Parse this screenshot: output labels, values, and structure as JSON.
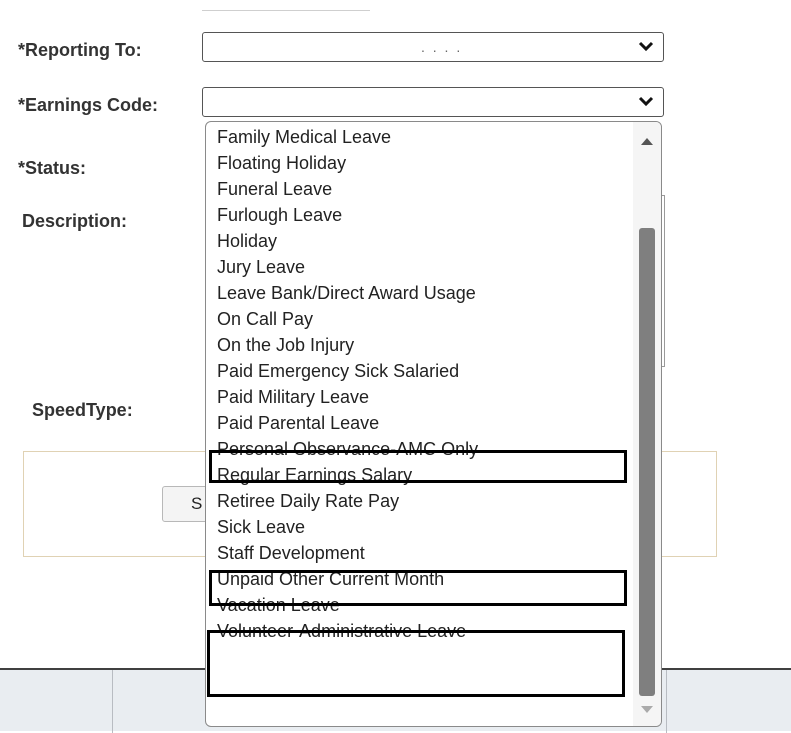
{
  "form": {
    "reporting_to_label": "*Reporting To:",
    "reporting_to_value": ". . . .",
    "earnings_code_label": "*Earnings Code:",
    "earnings_code_value": "",
    "status_label": "*Status:",
    "description_label": "Description:",
    "speedtype_label": "SpeedType:",
    "panel_button_label": "S"
  },
  "dropdown": {
    "options": [
      "Family Medical Leave",
      "Floating Holiday",
      "Funeral Leave",
      "Furlough Leave",
      "Holiday",
      "Jury Leave",
      "Leave Bank/Direct Award Usage",
      "On Call Pay",
      "On the Job Injury",
      "Paid Emergency Sick Salaried",
      "Paid Military Leave",
      "Paid Parental Leave",
      "Personal Observance-AMC Only",
      "Regular Earnings Salary",
      "Retiree Daily Rate Pay",
      "Sick Leave",
      "Staff Development",
      "Unpaid Other Current Month",
      "Vacation Leave",
      "Volunteer-Administrative Leave"
    ],
    "highlighted": [
      "Paid Parental Leave",
      "Sick Leave",
      "Unpaid Other Current Month",
      "Vacation Leave"
    ],
    "scroll_position": 0.7
  },
  "icons": {
    "select_chevron": "chevron-down-icon",
    "scroll_up": "scroll-up-arrow-icon",
    "scroll_down": "scroll-down-arrow-icon"
  },
  "colors": {
    "highlight_border": "#000000",
    "panel_border": "#e0d2b4",
    "scroll_thumb": "#7f7f7f"
  }
}
